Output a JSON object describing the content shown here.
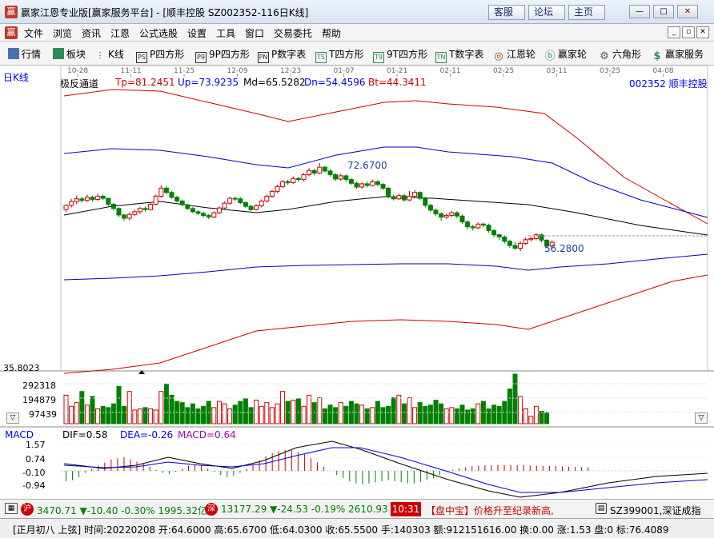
{
  "window": {
    "title": "赢家江恩专业版[赢家服务平台] - [顺丰控股  SZ002352-116日K线]",
    "logo": "赢",
    "buttons": [
      "客服",
      "论坛",
      "主页"
    ],
    "controls": [
      "—",
      "□",
      "✕"
    ]
  },
  "menu": {
    "logo": "赢",
    "items": [
      "文件",
      "浏览",
      "资讯",
      "江恩",
      "公式选股",
      "设置",
      "工具",
      "窗口",
      "交易委托",
      "帮助"
    ],
    "win_controls": [
      "_",
      "▫",
      "✕"
    ]
  },
  "toolbar": {
    "items": [
      {
        "label": "行情",
        "icon": "grid-icon"
      },
      {
        "label": "板块",
        "icon": "blocks-icon"
      },
      {
        "label": "K线",
        "icon": "candles-icon"
      },
      {
        "label": "P四方形",
        "icon": "p-square-icon",
        "badge": "PS"
      },
      {
        "label": "9P四方形",
        "icon": "9p-square-icon",
        "badge": "P9"
      },
      {
        "label": "P数字表",
        "icon": "p-table-icon",
        "badge": "PN"
      },
      {
        "label": "T四方形",
        "icon": "t-square-icon",
        "badge": "TS"
      },
      {
        "label": "9T四方形",
        "icon": "9t-square-icon",
        "badge": "T9"
      },
      {
        "label": "T数字表",
        "icon": "t-table-icon",
        "badge": "TN"
      },
      {
        "label": "江恩轮",
        "icon": "wheel-icon",
        "badge": "◎"
      },
      {
        "label": "赢家轮",
        "icon": "winner-wheel-icon",
        "badge": "ⓑ"
      },
      {
        "label": "六角形",
        "icon": "hexagon-icon",
        "badge": "⚙"
      },
      {
        "label": "赢家服务",
        "icon": "service-icon",
        "badge": "$"
      }
    ]
  },
  "chart": {
    "period_label": "日K线",
    "stock_label": "002352 顺丰控股",
    "date_ticks": [
      "10-28",
      "11-11",
      "11-25",
      "12-09",
      "12-23",
      "01-07",
      "01-21",
      "02-11",
      "02-25",
      "03-11",
      "03-25",
      "04-08"
    ],
    "indicator": {
      "name": "极反通道",
      "Tp": "Tp=81.2451",
      "Up": "Up=73.9235",
      "Md": "Md=65.5282",
      "Dn": "Dn=54.4596",
      "Bt": "Bt=44.3411"
    },
    "annotations": {
      "high": "72.6700",
      "low": "56.2800"
    },
    "volume": {
      "labels": [
        "35.8023",
        "292318",
        "194879",
        "97439"
      ],
      "scroll_icon": "▽"
    },
    "macd": {
      "name": "MACD",
      "dif": "DIF=0.58",
      "dea": "DEA=-0.26",
      "macd": "MACD=0.64",
      "axis": [
        "1.57",
        "0.74",
        "-0.10",
        "-0.94"
      ],
      "scroll_icon": "▽"
    }
  },
  "ticker": {
    "sh_badge": "沪",
    "sh": "3470.71 ▼-10.40 -0.30% 1995.32亿",
    "sz_badge": "深",
    "sz": "13177.29 ▼-24.53 -0.19% 2610.93",
    "time": "10:31",
    "news": "【盘中宝】价格升至纪录新高,",
    "code": "SZ399001,深证成指",
    "colors": {
      "up": "#c00000",
      "down": "#008000",
      "time_bg": "#c00000"
    }
  },
  "status": {
    "text": "[正月初八 上弦] 时间:20220208 开:64.6000 高:65.6700 低:64.0300 收:65.5500 手:140303 额:912151616.00 换:0.00 涨:1.53 盘:0 标:76.4089"
  },
  "chart_data": {
    "type": "candlestick",
    "price_axis_ref": {
      "high": 72.67,
      "low": 56.28
    },
    "candles": [
      [
        64.0,
        64.8,
        63.5,
        65.0
      ],
      [
        64.8,
        65.5,
        64.4,
        66.0
      ],
      [
        65.5,
        66.0,
        65.0,
        66.6
      ],
      [
        66.0,
        65.7,
        65.3,
        66.4
      ],
      [
        65.7,
        66.3,
        65.4,
        66.8
      ],
      [
        66.3,
        65.9,
        65.5,
        66.6
      ],
      [
        65.9,
        66.5,
        65.6,
        67.0
      ],
      [
        66.5,
        66.1,
        65.8,
        66.8
      ],
      [
        66.1,
        65.0,
        64.6,
        66.2
      ],
      [
        65.0,
        64.2,
        63.8,
        65.2
      ],
      [
        64.2,
        63.0,
        62.6,
        64.4
      ],
      [
        63.0,
        62.4,
        61.9,
        63.2
      ],
      [
        62.4,
        63.1,
        62.0,
        63.5
      ],
      [
        63.1,
        63.6,
        62.8,
        64.0
      ],
      [
        63.6,
        64.2,
        63.2,
        64.5
      ],
      [
        64.2,
        64.0,
        63.6,
        64.6
      ],
      [
        64.0,
        65.0,
        63.8,
        65.3
      ],
      [
        65.0,
        66.5,
        64.8,
        66.8
      ],
      [
        66.5,
        68.0,
        66.2,
        68.5
      ],
      [
        68.0,
        67.2,
        66.9,
        68.4
      ],
      [
        67.2,
        66.3,
        66.0,
        67.5
      ],
      [
        66.3,
        65.6,
        65.3,
        66.6
      ],
      [
        65.6,
        64.9,
        64.6,
        65.9
      ],
      [
        64.9,
        64.2,
        63.9,
        65.1
      ],
      [
        64.2,
        63.6,
        63.3,
        64.5
      ],
      [
        63.6,
        63.3,
        63.0,
        63.9
      ],
      [
        63.3,
        62.9,
        62.5,
        63.6
      ],
      [
        62.9,
        62.6,
        62.2,
        63.2
      ],
      [
        62.6,
        63.4,
        62.4,
        63.7
      ],
      [
        63.4,
        64.3,
        63.1,
        64.6
      ],
      [
        64.3,
        65.2,
        64.0,
        65.5
      ],
      [
        65.2,
        66.1,
        64.9,
        66.4
      ],
      [
        66.1,
        66.0,
        65.6,
        66.4
      ],
      [
        66.0,
        65.3,
        65.0,
        66.3
      ],
      [
        65.3,
        64.6,
        64.3,
        65.6
      ],
      [
        64.6,
        64.0,
        63.7,
        64.9
      ],
      [
        64.0,
        64.7,
        63.8,
        65.0
      ],
      [
        64.7,
        65.6,
        64.4,
        65.9
      ],
      [
        65.6,
        66.5,
        65.3,
        66.8
      ],
      [
        66.5,
        67.4,
        66.2,
        67.7
      ],
      [
        67.4,
        68.3,
        67.1,
        68.6
      ],
      [
        68.3,
        69.2,
        68.0,
        69.5
      ],
      [
        69.2,
        69.0,
        68.6,
        69.6
      ],
      [
        69.0,
        69.8,
        68.8,
        70.2
      ],
      [
        69.8,
        69.6,
        69.2,
        70.1
      ],
      [
        69.6,
        70.5,
        69.3,
        70.8
      ],
      [
        70.5,
        71.3,
        70.2,
        71.7
      ],
      [
        71.3,
        70.8,
        70.4,
        71.6
      ],
      [
        70.8,
        71.9,
        70.6,
        72.67
      ],
      [
        71.9,
        71.2,
        70.9,
        72.2
      ],
      [
        71.2,
        70.5,
        70.1,
        71.5
      ],
      [
        70.5,
        69.7,
        69.3,
        70.8
      ],
      [
        69.7,
        70.3,
        69.4,
        70.7
      ],
      [
        70.3,
        69.6,
        69.2,
        70.6
      ],
      [
        69.6,
        68.9,
        68.6,
        69.9
      ],
      [
        68.9,
        68.2,
        67.9,
        69.2
      ],
      [
        68.2,
        68.8,
        67.9,
        69.1
      ],
      [
        68.8,
        68.5,
        68.1,
        69.2
      ],
      [
        68.5,
        69.2,
        68.3,
        69.6
      ],
      [
        69.2,
        68.7,
        68.3,
        69.5
      ],
      [
        68.7,
        68.0,
        67.6,
        69.0
      ],
      [
        68.0,
        66.4,
        66.1,
        68.2
      ],
      [
        66.4,
        66.0,
        65.7,
        66.8
      ],
      [
        66.0,
        66.6,
        65.8,
        67.0
      ],
      [
        66.6,
        65.8,
        65.5,
        66.9
      ],
      [
        65.8,
        66.5,
        65.6,
        67.5
      ],
      [
        66.5,
        67.2,
        66.2,
        67.6
      ],
      [
        67.2,
        66.1,
        65.8,
        67.4
      ],
      [
        66.1,
        64.8,
        64.4,
        66.4
      ],
      [
        64.8,
        63.9,
        63.5,
        65.1
      ],
      [
        63.9,
        63.2,
        62.8,
        64.2
      ],
      [
        63.2,
        62.6,
        61.9,
        63.5
      ],
      [
        62.6,
        62.9,
        62.3,
        63.3
      ],
      [
        62.9,
        63.4,
        62.6,
        63.8
      ],
      [
        63.4,
        62.8,
        62.4,
        63.7
      ],
      [
        62.8,
        61.7,
        61.3,
        63.1
      ],
      [
        61.7,
        60.8,
        60.3,
        62.0
      ],
      [
        60.8,
        60.6,
        60.1,
        61.2
      ],
      [
        60.6,
        61.3,
        60.3,
        61.6
      ],
      [
        61.3,
        61.1,
        60.7,
        61.6
      ],
      [
        61.1,
        60.1,
        59.7,
        61.4
      ],
      [
        60.1,
        59.3,
        58.8,
        60.4
      ],
      [
        59.3,
        58.9,
        58.3,
        59.5
      ],
      [
        58.9,
        58.1,
        57.7,
        59.2
      ],
      [
        58.1,
        57.3,
        56.9,
        58.4
      ],
      [
        57.3,
        56.8,
        56.5,
        58.0
      ],
      [
        56.8,
        57.7,
        56.28,
        58.1
      ],
      [
        57.7,
        58.4,
        57.4,
        58.8
      ],
      [
        58.4,
        58.6,
        58.1,
        59.0
      ],
      [
        58.6,
        59.3,
        58.3,
        59.6
      ],
      [
        59.3,
        58.3,
        57.9,
        59.5
      ],
      [
        58.3,
        57.2,
        56.9,
        58.5
      ],
      [
        57.2,
        57.9,
        56.9,
        58.3
      ]
    ],
    "volume": [
      230,
      140,
      170,
      260,
      150,
      220,
      120,
      140,
      130,
      160,
      300,
      140,
      260,
      110,
      120,
      130,
      120,
      110,
      260,
      320,
      230,
      180,
      170,
      130,
      160,
      120,
      140,
      180,
      130,
      180,
      160,
      120,
      150,
      180,
      200,
      130,
      190,
      140,
      170,
      130,
      160,
      260,
      180,
      190,
      200,
      140,
      230,
      170,
      210,
      120,
      150,
      130,
      170,
      140,
      180,
      160,
      150,
      120,
      130,
      180,
      130,
      140,
      210,
      230,
      160,
      210,
      130,
      170,
      140,
      150,
      190,
      160,
      120,
      130,
      120,
      150,
      110,
      120,
      160,
      180,
      120,
      150,
      140,
      180,
      280,
      400,
      220,
      120,
      60,
      140,
      100,
      90
    ],
    "macd_hist": [
      -0.5,
      -0.45,
      -0.3,
      -0.1,
      0.1,
      0.25,
      0.4,
      0.55,
      0.6,
      0.65,
      0.55,
      0.45,
      0.35,
      0.2,
      0.05,
      -0.1,
      -0.15,
      -0.05,
      0.1,
      0.25,
      0.3,
      0.25,
      0.1,
      -0.05,
      -0.2,
      -0.3,
      -0.25,
      -0.1,
      0.1,
      0.3,
      0.5,
      0.7,
      0.85,
      0.95,
      1.0,
      1.0,
      0.9,
      0.8,
      0.6,
      0.4,
      0.2,
      0.0,
      -0.2,
      -0.35,
      -0.5,
      -0.6,
      -0.65,
      -0.6,
      -0.55,
      -0.5,
      -0.45,
      -0.5,
      -0.55,
      -0.6,
      -0.6,
      -0.55,
      -0.45,
      -0.35,
      -0.2,
      -0.05,
      0.05,
      0.12,
      0.18,
      0.22,
      0.25,
      0.26,
      0.27,
      0.28,
      0.28,
      0.28,
      0.28,
      0.27,
      0.26,
      0.25,
      0.24,
      0.23,
      0.22,
      0.21,
      0.2,
      0.19,
      0.18,
      0.17
    ]
  }
}
